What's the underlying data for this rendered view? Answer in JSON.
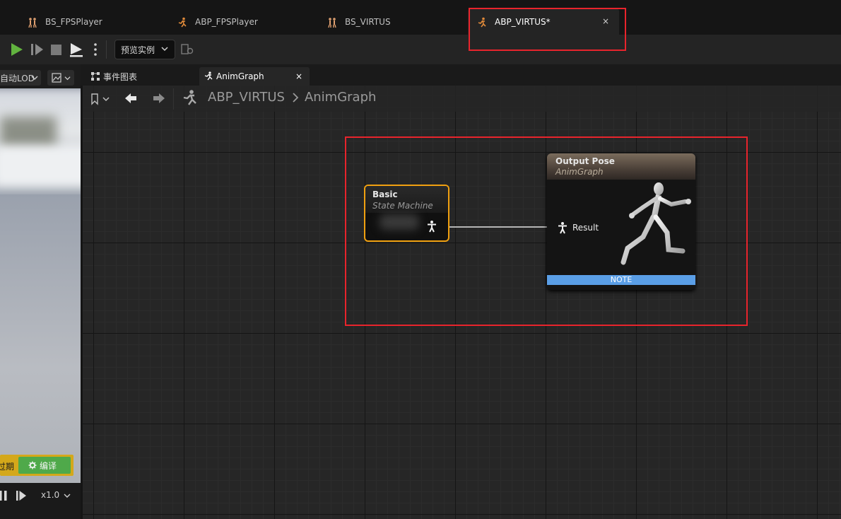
{
  "doc_tabs": [
    {
      "label": "BS_FPSPlayer",
      "icon": "blendspace-icon"
    },
    {
      "label": "ABP_FPSPlayer",
      "icon": "anim-blueprint-icon"
    },
    {
      "label": "BS_VIRTUS",
      "icon": "blendspace-icon"
    },
    {
      "label": "ABP_VIRTUS*",
      "icon": "anim-blueprint-icon",
      "active": true,
      "close": "×"
    }
  ],
  "toolbar": {
    "preview_instance": "预览实例"
  },
  "viewport": {
    "lod": "自动LOD",
    "compile_status": "过期",
    "compile_label": "编译",
    "speed": "x1.0"
  },
  "graph_tabs": {
    "events": "事件图表",
    "anim": "AnimGraph",
    "close": "×"
  },
  "breadcrumb": {
    "root": "ABP_VIRTUS",
    "current": "AnimGraph"
  },
  "nodes": {
    "basic": {
      "title": "Basic",
      "subtitle": "State Machine"
    },
    "output": {
      "title": "Output Pose",
      "subtitle": "AnimGraph",
      "pin": "Result",
      "note": "NOTE"
    }
  },
  "colors": {
    "highlight": "#e8242c",
    "selected_node_border": "#f0a010",
    "note_bar": "#5a9ee6",
    "compile_green": "#4fa94a",
    "compile_warning": "#d4a81a"
  }
}
